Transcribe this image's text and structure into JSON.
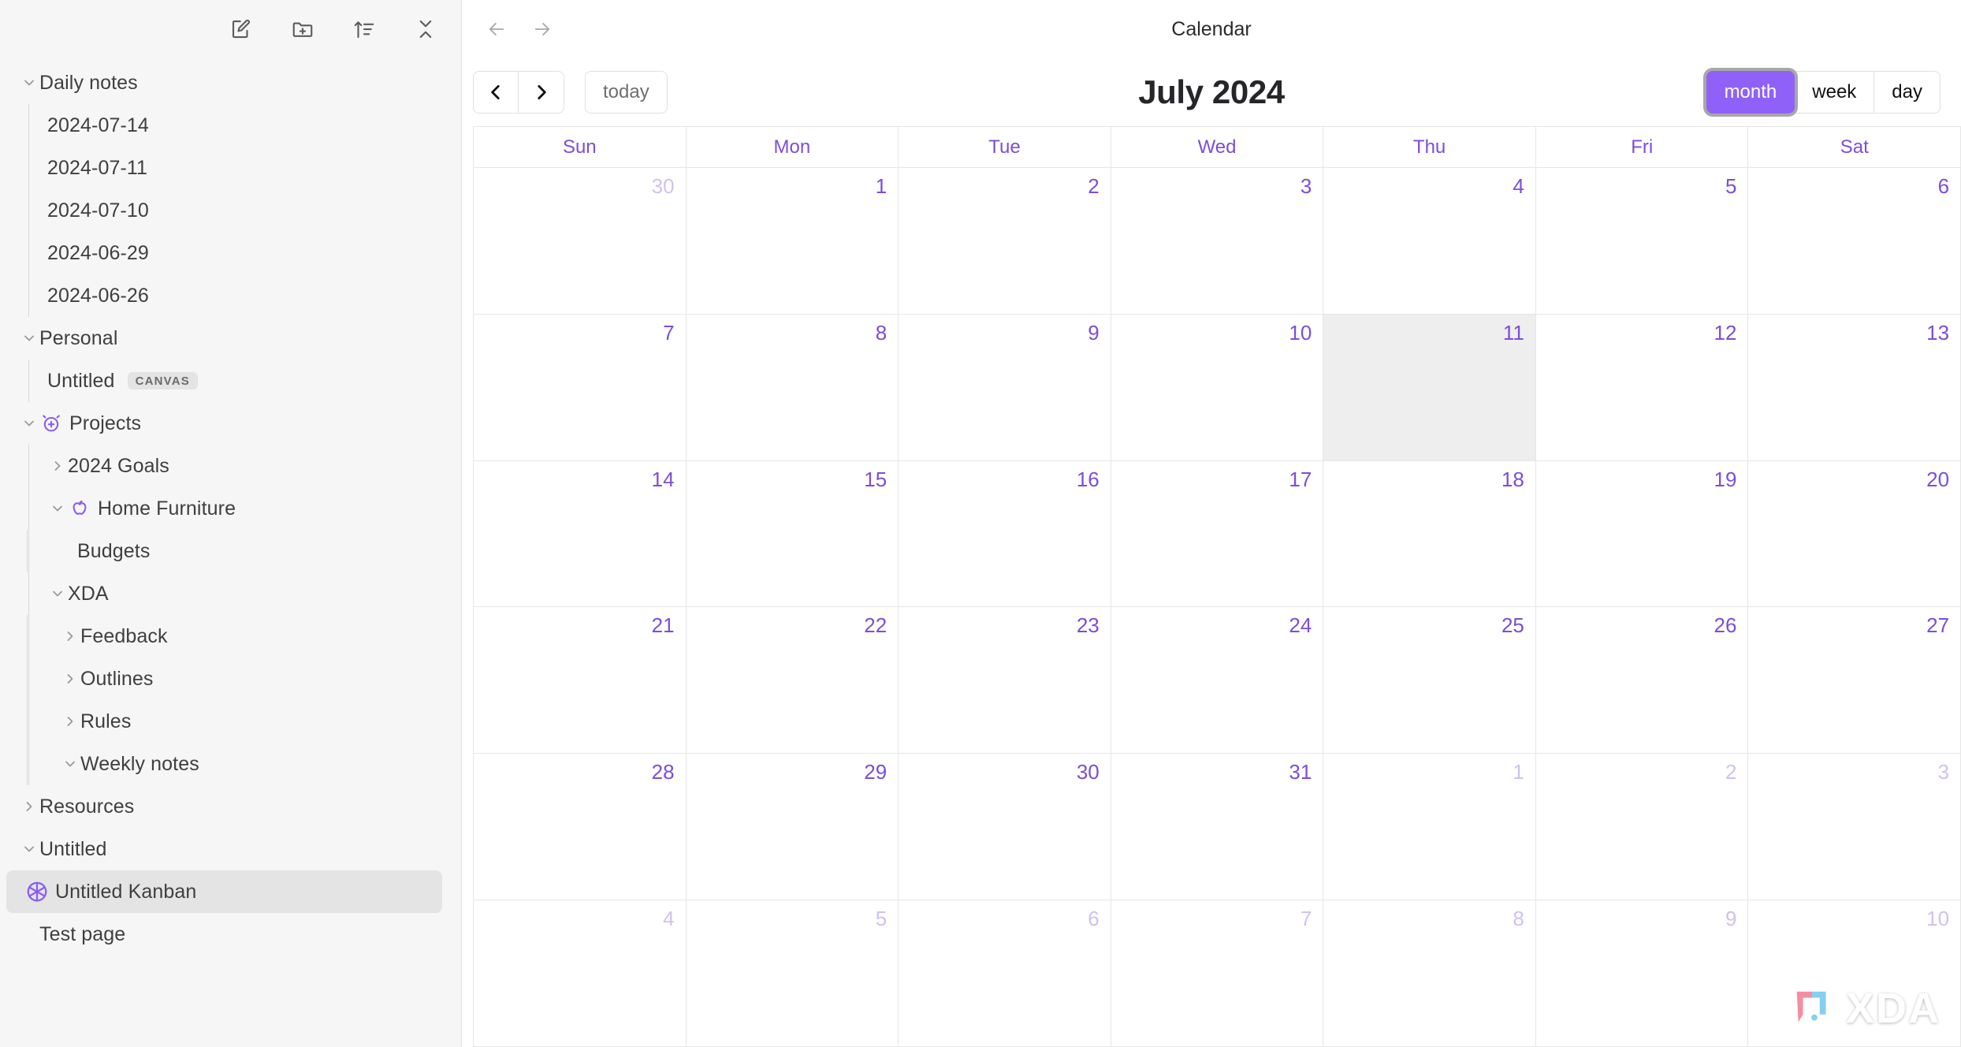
{
  "sidebar": {
    "toolbar": [
      {
        "name": "new-note-icon",
        "title": "New note"
      },
      {
        "name": "new-folder-icon",
        "title": "New folder"
      },
      {
        "name": "sort-icon",
        "title": "Change sort order"
      },
      {
        "name": "collapse-all-icon",
        "title": "Collapse all"
      }
    ],
    "tree": [
      {
        "label": "Daily notes",
        "expanded": true,
        "children": [
          {
            "label": "2024-07-14"
          },
          {
            "label": "2024-07-11"
          },
          {
            "label": "2024-07-10"
          },
          {
            "label": "2024-06-29"
          },
          {
            "label": "2024-06-26"
          }
        ]
      },
      {
        "label": "Personal",
        "expanded": true,
        "children": [
          {
            "label": "Untitled",
            "badge": "CANVAS"
          }
        ]
      },
      {
        "label": "Projects",
        "expanded": true,
        "icon": "alarm-clock-plus-icon",
        "children": [
          {
            "label": "2024 Goals",
            "expanded": false
          },
          {
            "label": "Home Furniture",
            "expanded": true,
            "icon": "apple-icon",
            "children": [
              {
                "label": "Budgets"
              }
            ]
          },
          {
            "label": "XDA",
            "expanded": true,
            "children": [
              {
                "label": "Feedback",
                "expanded": false
              },
              {
                "label": "Outlines",
                "expanded": false
              },
              {
                "label": "Rules",
                "expanded": false
              },
              {
                "label": "Weekly notes",
                "expanded": true
              }
            ]
          }
        ]
      },
      {
        "label": "Resources",
        "expanded": false
      },
      {
        "label": "Untitled",
        "expanded": true,
        "children": [
          {
            "label": "Untitled Kanban",
            "icon": "aperture-icon",
            "selected": true
          }
        ]
      },
      {
        "label": "Test page"
      }
    ]
  },
  "header": {
    "title": "Calendar",
    "back_icon": "arrow-left-icon",
    "forward_icon": "arrow-right-icon"
  },
  "calendar": {
    "prev_icon": "chevron-left-icon",
    "next_icon": "chevron-right-icon",
    "today_label": "today",
    "title": "July 2024",
    "views": [
      {
        "label": "month",
        "active": true
      },
      {
        "label": "week",
        "active": false
      },
      {
        "label": "day",
        "active": false
      }
    ],
    "day_headers": [
      "Sun",
      "Mon",
      "Tue",
      "Wed",
      "Thu",
      "Fri",
      "Sat"
    ],
    "accent_color": "#9061f9",
    "day_number_color": "#7c4ddb",
    "weeks": [
      [
        {
          "n": "30",
          "other": true
        },
        {
          "n": "1"
        },
        {
          "n": "2"
        },
        {
          "n": "3"
        },
        {
          "n": "4"
        },
        {
          "n": "5"
        },
        {
          "n": "6"
        }
      ],
      [
        {
          "n": "7"
        },
        {
          "n": "8"
        },
        {
          "n": "9"
        },
        {
          "n": "10"
        },
        {
          "n": "11",
          "today": true
        },
        {
          "n": "12"
        },
        {
          "n": "13"
        }
      ],
      [
        {
          "n": "14"
        },
        {
          "n": "15"
        },
        {
          "n": "16"
        },
        {
          "n": "17"
        },
        {
          "n": "18"
        },
        {
          "n": "19"
        },
        {
          "n": "20"
        }
      ],
      [
        {
          "n": "21"
        },
        {
          "n": "22"
        },
        {
          "n": "23"
        },
        {
          "n": "24"
        },
        {
          "n": "25"
        },
        {
          "n": "26"
        },
        {
          "n": "27"
        }
      ],
      [
        {
          "n": "28"
        },
        {
          "n": "29"
        },
        {
          "n": "30"
        },
        {
          "n": "31"
        },
        {
          "n": "1",
          "other": true
        },
        {
          "n": "2",
          "other": true
        },
        {
          "n": "3",
          "other": true
        }
      ],
      [
        {
          "n": "4",
          "other": true
        },
        {
          "n": "5",
          "other": true
        },
        {
          "n": "6",
          "other": true
        },
        {
          "n": "7",
          "other": true
        },
        {
          "n": "8",
          "other": true
        },
        {
          "n": "9",
          "other": true
        },
        {
          "n": "10",
          "other": true
        }
      ]
    ]
  },
  "watermark": {
    "text": "XDA"
  }
}
